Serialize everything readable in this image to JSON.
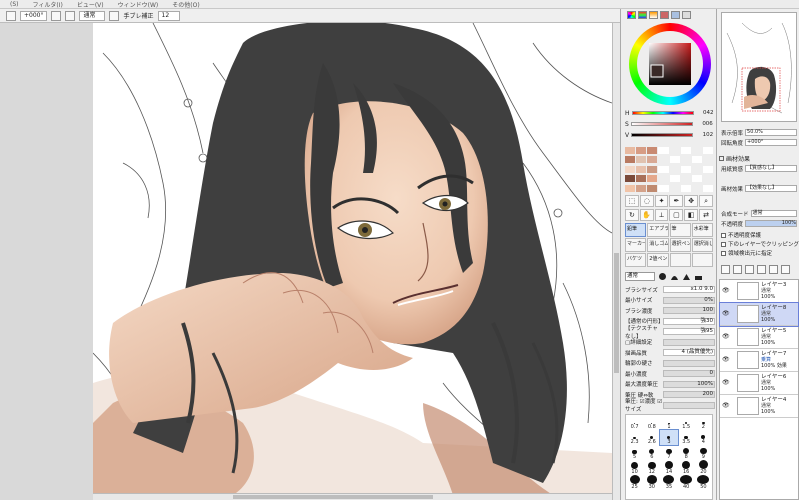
{
  "menu": [
    "(S)",
    "フィルタ(I)",
    "ビュー(V)",
    "ウィンドウ(W)",
    "その他(O)"
  ],
  "toolbar": {
    "angle": "+000°",
    "blend_mode": "通常",
    "stabilizer_label": "手ブレ補正",
    "stabilizer_value": "12"
  },
  "color": {
    "hsv": [
      {
        "label": "H",
        "value": "042"
      },
      {
        "label": "S",
        "value": "006"
      },
      {
        "label": "V",
        "value": "102"
      }
    ],
    "swatches": [
      "#e8b9a0",
      "#d79c84",
      "#c98a72",
      "#fff",
      "#eee",
      "#fff",
      "#eee",
      "#fff",
      "#b87a62",
      "#e0c2b0",
      "#d8a995",
      "#eee",
      "#fff",
      "#eee",
      "#fff",
      "#eee",
      "#f2d7c6",
      "#e7c1ad",
      "#cb9b85",
      "#fff",
      "#eee",
      "#fff",
      "#eee",
      "#fff",
      "#7a4a3a",
      "#a8705a",
      "#e4a88c",
      "#eee",
      "#fff",
      "#eee",
      "#fff",
      "#eee",
      "#f1c4a8",
      "#d4a28a",
      "#bf8a70",
      "#fff",
      "#eee",
      "#fff",
      "#eee",
      "#fff"
    ]
  },
  "brushes": [
    "鉛筆",
    "エアブラシ",
    "筆",
    "水彩筆",
    "マーカー",
    "消しゴム",
    "選択ペン",
    "選択消し",
    "バケツ",
    "2値ペン",
    "",
    ""
  ],
  "brush_shapes": {
    "mode": "通常"
  },
  "brush_props": [
    {
      "k": "ブラシサイズ",
      "v": "x1.0    9.0",
      "white": true
    },
    {
      "k": "最小サイズ",
      "v": "0%",
      "white": false
    },
    {
      "k": "ブラシ濃度",
      "v": "100",
      "white": false
    },
    {
      "k": "【通常の円形】",
      "v": "強30",
      "white": true
    },
    {
      "k": "【テクスチャなし】",
      "v": "強95",
      "white": true
    },
    {
      "k": "▢詳細設定",
      "v": "",
      "white": false
    },
    {
      "k": "描画品質",
      "v": "4 (品質優先)",
      "white": true
    },
    {
      "k": "輪郭の硬さ",
      "v": "",
      "white": false
    },
    {
      "k": "最小濃度",
      "v": "0",
      "white": false
    },
    {
      "k": "最大濃度筆圧",
      "v": "100%",
      "white": false
    },
    {
      "k": "筆圧 硬⇔軟",
      "v": "200",
      "white": false
    },
    {
      "k": "筆圧: ☑濃度 ☑サイズ",
      "v": "",
      "white": false
    }
  ],
  "dots": [
    {
      "l": "0.7",
      "s": 1
    },
    {
      "l": "0.8",
      "s": 1
    },
    {
      "l": "1",
      "s": 1.5
    },
    {
      "l": "1.5",
      "s": 2
    },
    {
      "l": "2",
      "s": 2.5
    },
    {
      "l": "2.3",
      "s": 2.5
    },
    {
      "l": "2.6",
      "s": 3
    },
    {
      "l": "3",
      "s": 3,
      "sel": true
    },
    {
      "l": "3.5",
      "s": 3.5
    },
    {
      "l": "4",
      "s": 4
    },
    {
      "l": "5",
      "s": 4.5
    },
    {
      "l": "6",
      "s": 5
    },
    {
      "l": "7",
      "s": 5.5
    },
    {
      "l": "8",
      "s": 6
    },
    {
      "l": "9",
      "s": 6.5
    },
    {
      "l": "10",
      "s": 7
    },
    {
      "l": "12",
      "s": 7.5
    },
    {
      "l": "14",
      "s": 8
    },
    {
      "l": "16",
      "s": 8.5
    },
    {
      "l": "20",
      "s": 9
    },
    {
      "l": "25",
      "s": 10
    },
    {
      "l": "30",
      "s": 10.5
    },
    {
      "l": "35",
      "s": 11
    },
    {
      "l": "40",
      "s": 11.5
    },
    {
      "l": "50",
      "s": 12
    }
  ],
  "navigator": {
    "zoom_label": "表示倍率",
    "zoom_value": "50.0%",
    "angle_label": "回転角度",
    "angle_value": "+000°"
  },
  "paper": {
    "section": "画材効果",
    "texture_label": "用紙質感",
    "texture_value": "【質感なし】",
    "effect_label": "画材効果",
    "effect_value": "【効果なし】"
  },
  "layer_props": {
    "blend_label": "合成モード",
    "blend_value": "通常",
    "opacity_label": "不透明度",
    "opacity_value": "100%",
    "opts": [
      "不透明度保護",
      "下のレイヤーでクリッピング",
      "領域検出元に指定"
    ]
  },
  "layers": [
    {
      "name": "レイヤー3",
      "mode": "通常",
      "opacity": "100%",
      "sel": false,
      "blend": false
    },
    {
      "name": "レイヤー8",
      "mode": "通常",
      "opacity": "100%",
      "sel": true,
      "blend": false
    },
    {
      "name": "レイヤー5",
      "mode": "通常",
      "opacity": "100%",
      "sel": false,
      "blend": false
    },
    {
      "name": "レイヤー7",
      "mode": "乗算",
      "opacity": "100% 効果",
      "sel": false,
      "blend": true
    },
    {
      "name": "レイヤー6",
      "mode": "通常",
      "opacity": "100%",
      "sel": false,
      "blend": false
    },
    {
      "name": "レイヤー4",
      "mode": "通常",
      "opacity": "100%",
      "sel": false,
      "blend": false
    }
  ]
}
